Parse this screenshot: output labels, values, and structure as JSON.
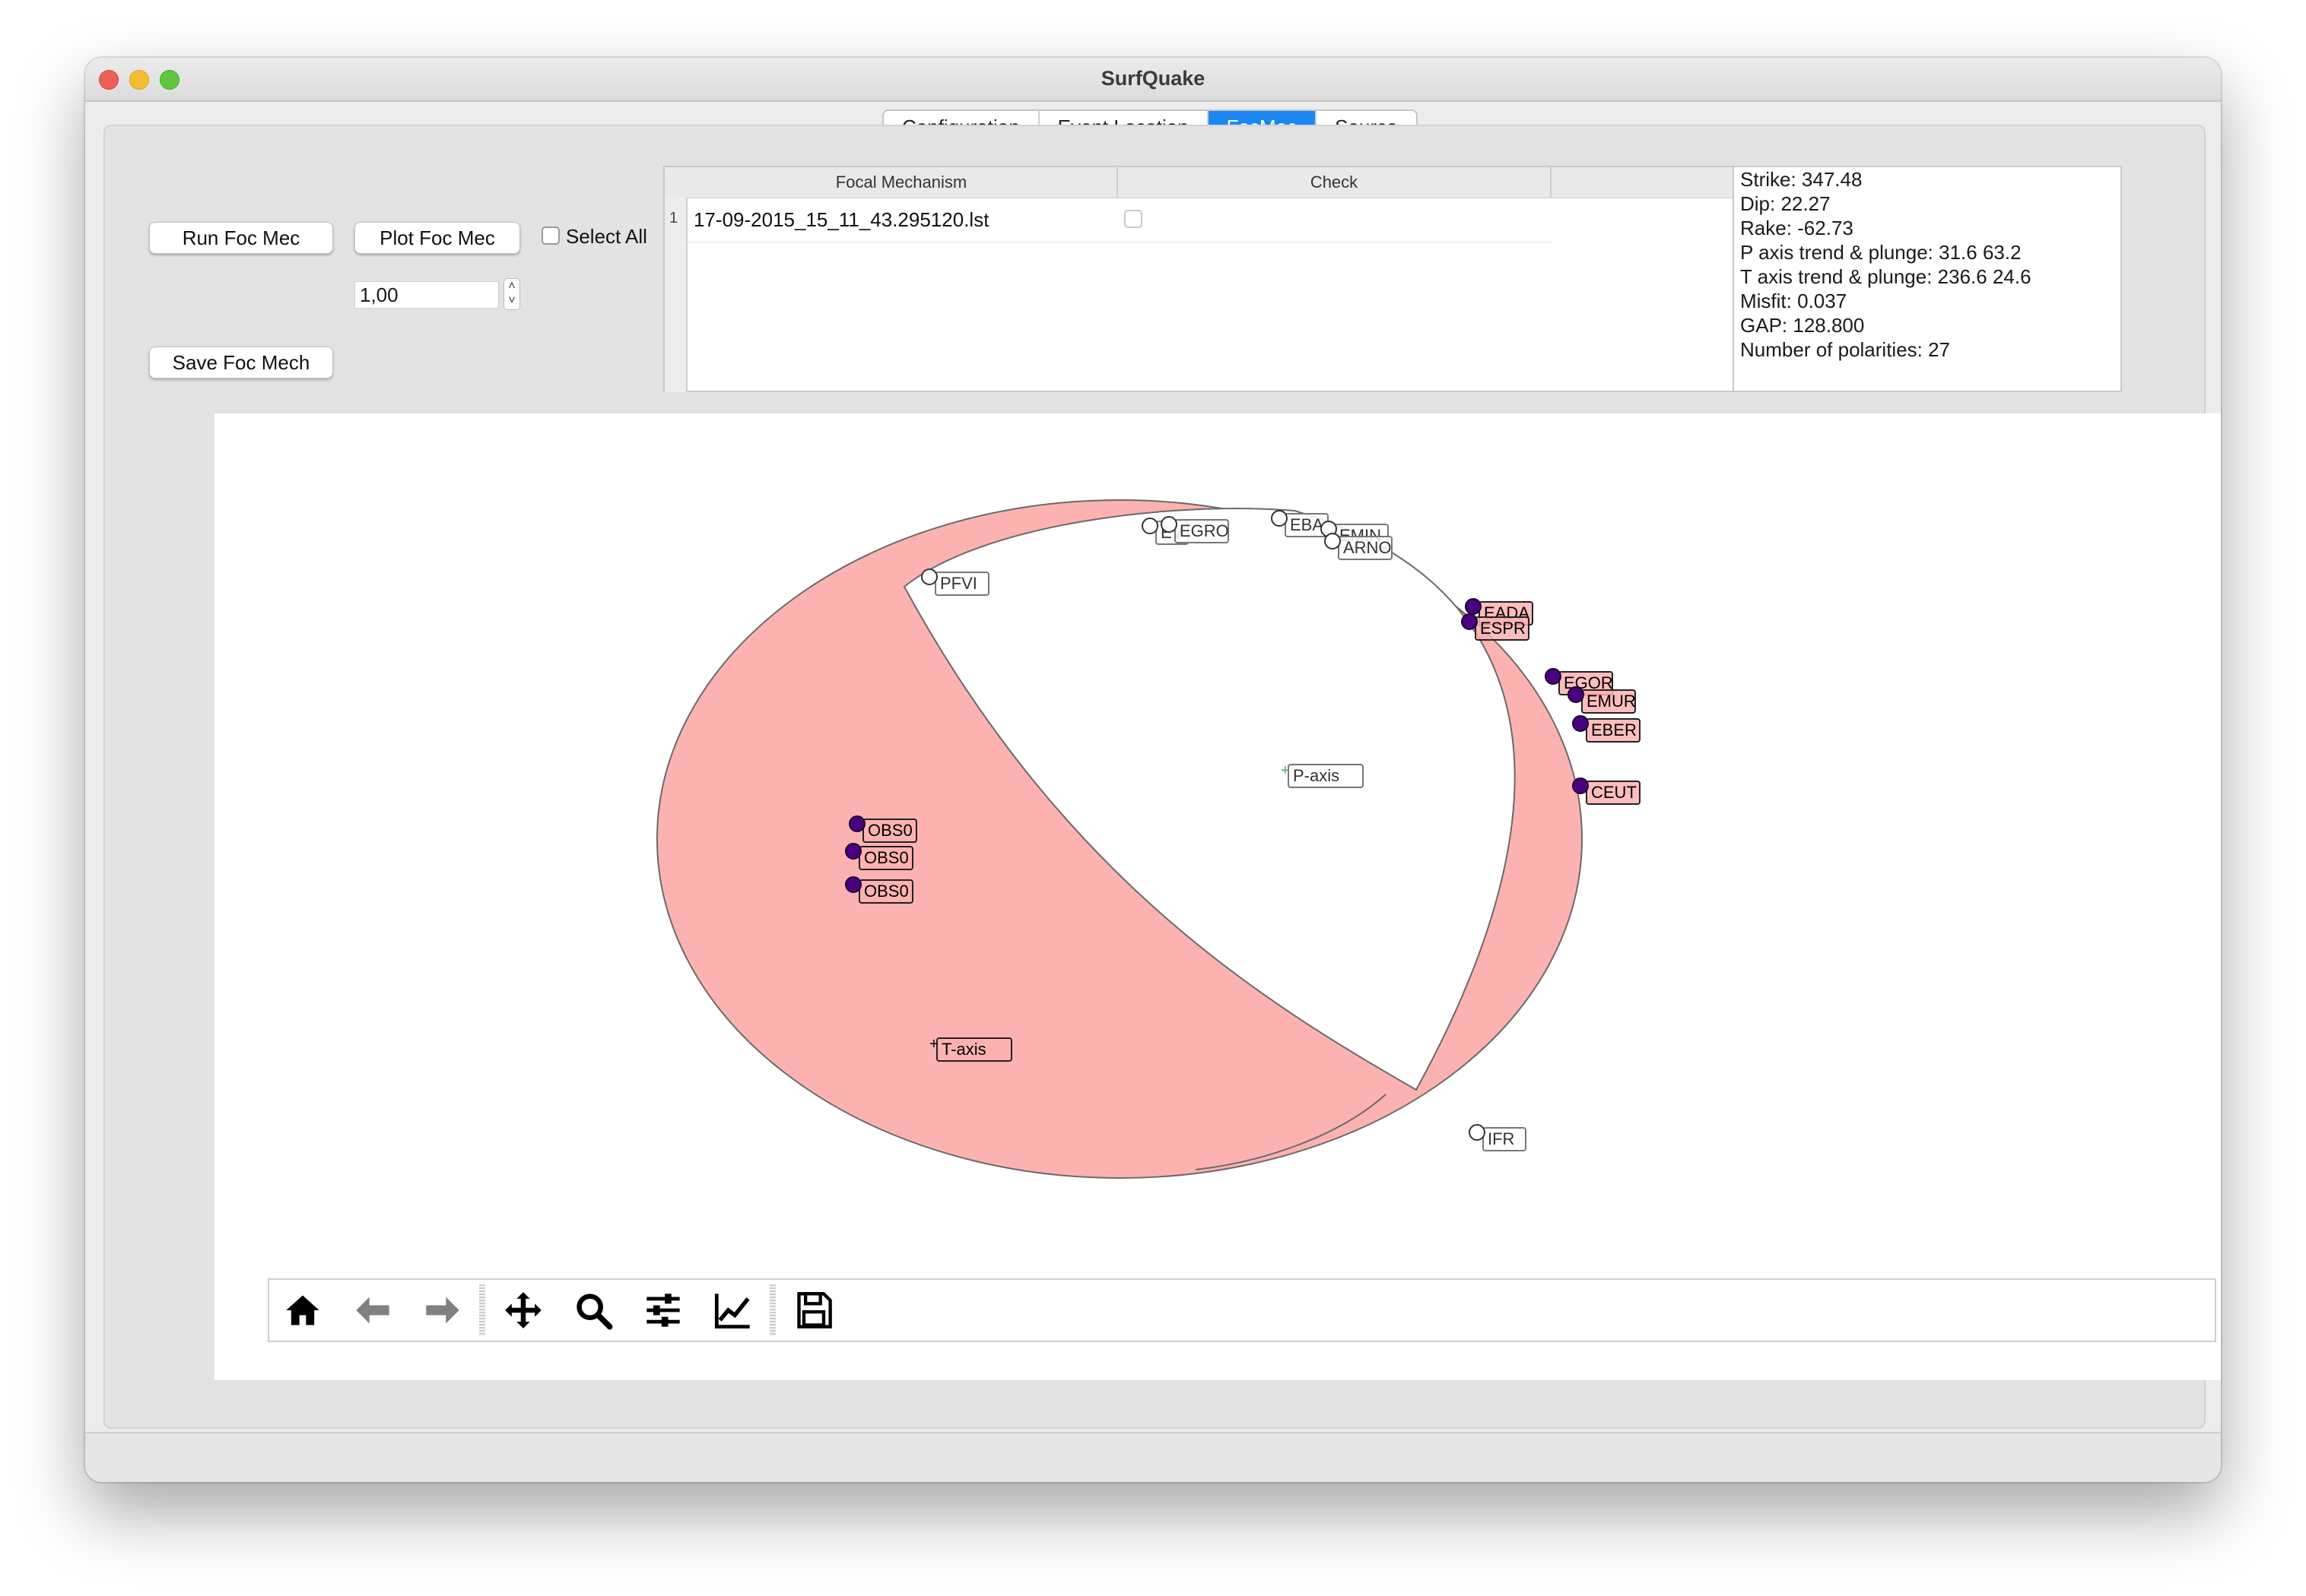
{
  "window": {
    "title": "SurfQuake"
  },
  "tabs": [
    {
      "label": "Configuration"
    },
    {
      "label": "Event Location"
    },
    {
      "label": "FocMec"
    },
    {
      "label": "Source"
    }
  ],
  "controls": {
    "run_label": "Run Foc Mec",
    "plot_label": "Plot Foc Mec",
    "select_all_label": "Select All",
    "save_label": "Save Foc Mech",
    "spin_value": "1,00"
  },
  "table": {
    "headers": [
      "Focal Mechanism",
      "Check"
    ],
    "rows": [
      {
        "index": "1",
        "file": "17-09-2015_15_11_43.295120.lst",
        "checked": false
      }
    ]
  },
  "results": {
    "lines": [
      "Strike: 347.48",
      "Dip: 22.27",
      "Rake: -62.73",
      "P axis trend & plunge: 31.6 63.2",
      "T axis trend & plunge: 236.6 24.6",
      "Misfit: 0.037",
      "GAP: 128.800",
      "Number of polarities: 27"
    ]
  },
  "beachball": {
    "fill_color": "#fdb2b2",
    "compression_color": "#4b0082",
    "axes": [
      {
        "label": "P-axis",
        "trend": 31.6,
        "plunge": 63.2
      },
      {
        "label": "T-axis",
        "trend": 236.6,
        "plunge": 24.6
      }
    ],
    "stations": [
      {
        "label": "EV",
        "polarity": "dilatation"
      },
      {
        "label": "EGRO",
        "polarity": "dilatation"
      },
      {
        "label": "EBA",
        "polarity": "dilatation"
      },
      {
        "label": "EMIN",
        "polarity": "dilatation"
      },
      {
        "label": "ARNO",
        "polarity": "dilatation"
      },
      {
        "label": "PFVI",
        "polarity": "dilatation"
      },
      {
        "label": "EADA",
        "polarity": "compression"
      },
      {
        "label": "ESPR",
        "polarity": "compression"
      },
      {
        "label": "EGOR",
        "polarity": "compression"
      },
      {
        "label": "EMUR",
        "polarity": "compression"
      },
      {
        "label": "EBER",
        "polarity": "compression"
      },
      {
        "label": "CEUT",
        "polarity": "compression"
      },
      {
        "label": "OBS0",
        "polarity": "compression"
      },
      {
        "label": "OBS0",
        "polarity": "compression"
      },
      {
        "label": "OBS0",
        "polarity": "compression"
      },
      {
        "label": "IFR",
        "polarity": "dilatation"
      }
    ]
  },
  "toolbar": {
    "icons": [
      "home-icon",
      "back-arrow-icon",
      "forward-arrow-icon",
      "pan-icon",
      "zoom-icon",
      "configure-subplots-icon",
      "edit-axis-icon",
      "save-icon"
    ]
  }
}
